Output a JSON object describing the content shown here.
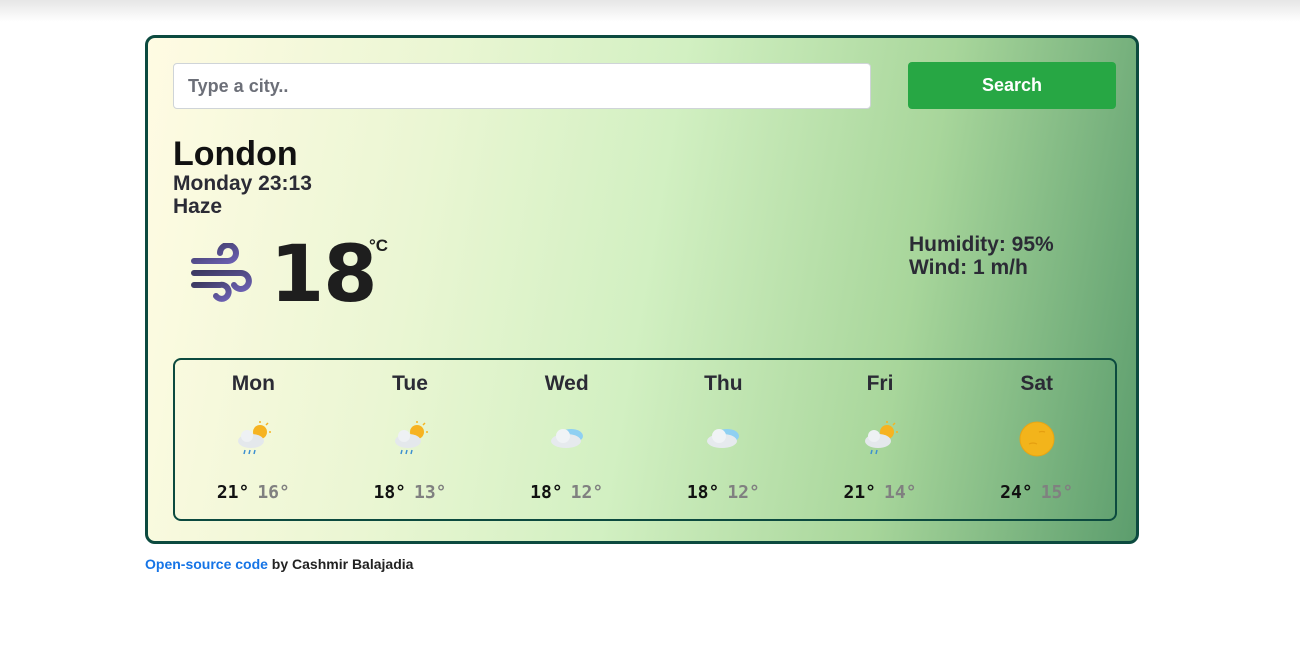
{
  "search": {
    "placeholder": "Type a city..",
    "value": "",
    "button_label": "Search"
  },
  "current": {
    "city": "London",
    "datetime": "Monday 23:13",
    "condition": "Haze",
    "icon": "wind-icon",
    "temperature": "18",
    "unit": "°C",
    "humidity": "Humidity: 95%",
    "wind": "Wind: 1 m/h"
  },
  "forecast": [
    {
      "day": "Mon",
      "icon": "sun-cloud-rain-icon",
      "high": "21°",
      "low": "16°"
    },
    {
      "day": "Tue",
      "icon": "sun-cloud-rain-icon",
      "high": "18°",
      "low": "13°"
    },
    {
      "day": "Wed",
      "icon": "cloud-icon",
      "high": "18°",
      "low": "12°"
    },
    {
      "day": "Thu",
      "icon": "cloud-icon",
      "high": "18°",
      "low": "12°"
    },
    {
      "day": "Fri",
      "icon": "sun-cloud-rain-icon",
      "high": "21°",
      "low": "14°"
    },
    {
      "day": "Sat",
      "icon": "sun-icon",
      "high": "24°",
      "low": "15°"
    }
  ],
  "footer": {
    "link_text": "Open-source code",
    "text": " by Cashmir Balajadia"
  },
  "colors": {
    "accent": "#27a744",
    "border": "#0c4a3f",
    "link": "#1574e6"
  }
}
